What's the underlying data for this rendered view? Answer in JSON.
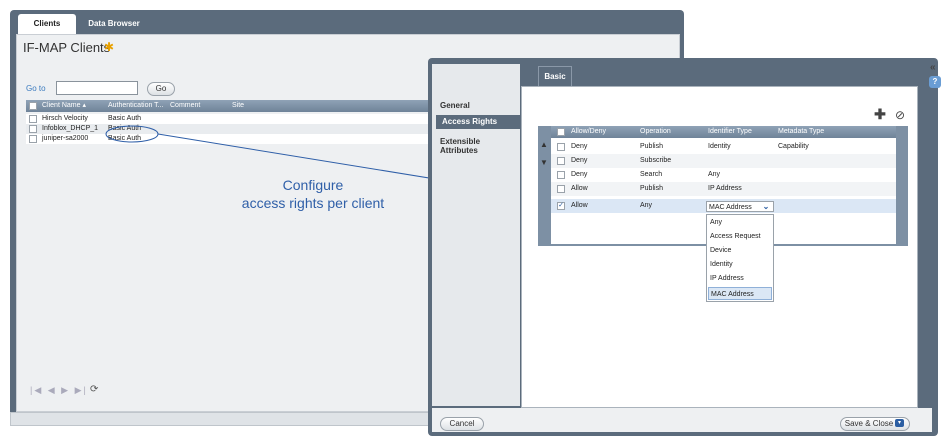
{
  "tabs": {
    "clients": "Clients",
    "data_browser": "Data Browser"
  },
  "clients_panel": {
    "title": "IF-MAP Clients",
    "goto_label": "Go to",
    "goto_value": "",
    "go_button": "Go",
    "columns": [
      "Client Name ▴",
      "Authentication T...",
      "Comment",
      "Site"
    ],
    "rows": [
      {
        "name": "Hirsch Velocity",
        "auth": "Basic Auth"
      },
      {
        "name": "Infoblox_DHCP_1",
        "auth": "Basic Auth"
      },
      {
        "name": "juniper-sa2000",
        "auth": "Basic Auth"
      }
    ],
    "pager": "|◀ ◀ ▶ ▶|"
  },
  "annotation": {
    "line1": "Configure",
    "line2": "access rights per client"
  },
  "dialog": {
    "nav": {
      "general": "General",
      "access_rights": "Access Rights",
      "extensible_1": "Extensible",
      "extensible_2": "Attributes"
    },
    "tab_basic": "Basic",
    "columns": [
      "Allow/Deny",
      "Operation",
      "Identifier Type",
      "Metadata Type"
    ],
    "rows": [
      {
        "allow": "Deny",
        "operation": "Publish",
        "identifier": "Identity",
        "metadata": "Capability"
      },
      {
        "allow": "Deny",
        "operation": "Subscribe",
        "identifier": "",
        "metadata": ""
      },
      {
        "allow": "Deny",
        "operation": "Search",
        "identifier": "Any",
        "metadata": ""
      },
      {
        "allow": "Allow",
        "operation": "Publish",
        "identifier": "IP Address",
        "metadata": ""
      },
      {
        "allow": "Allow",
        "operation": "Any",
        "identifier": "MAC Address",
        "metadata": ""
      }
    ],
    "selected_identifier": "MAC Address",
    "dropdown_options": [
      "Any",
      "Access Request",
      "Device",
      "Identity",
      "IP Address",
      "MAC Address"
    ],
    "cancel_button": "Cancel",
    "save_close_button": "Save & Close"
  },
  "colors": {
    "window_chrome": "#5b6b7c",
    "accent_blue": "#2f5fa8",
    "selected_row": "#dbe7f5"
  }
}
